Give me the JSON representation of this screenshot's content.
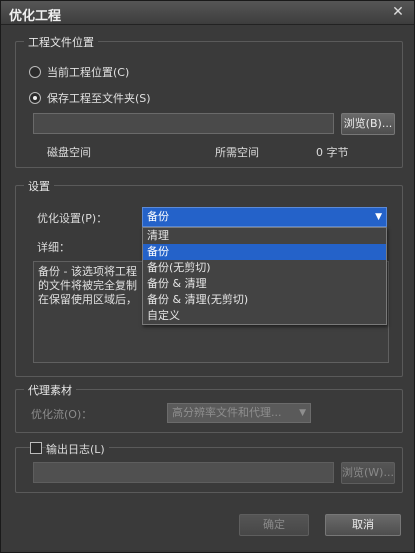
{
  "window": {
    "title": "优化工程",
    "close": "✕"
  },
  "project_location": {
    "group_title": "工程文件位置",
    "radio_current": "当前工程位置(C)",
    "radio_save": "保存工程至文件夹(S)",
    "folder_value": "",
    "browse_label": "浏览(B)...",
    "disk_space_label": "磁盘空间",
    "required_space_label": "所需空间",
    "required_space_value": "0 字节"
  },
  "settings": {
    "group_title": "设置",
    "optimize_label": "优化设置(P)：",
    "optimize_value": "备份",
    "detail_label": "详细：",
    "options": [
      "清理",
      "备份",
      "备份(无剪切)",
      "备份 & 清理",
      "备份 & 清理(无剪切)",
      "自定义"
    ],
    "selected_index": 1,
    "description_lines": [
      "备份 - 该选项将工程",
      "的文件将被完全复制",
      "在保留使用区域后，"
    ]
  },
  "proxy": {
    "group_title": "代理素材",
    "flow_label": "优化流(O)：",
    "flow_value": "高分辨率文件和代理..."
  },
  "log": {
    "checkbox_label": "输出日志(L)",
    "checked": false,
    "path_value": "",
    "browse_label": "浏览(W)..."
  },
  "footer": {
    "ok_label": "确定",
    "cancel_label": "取消"
  }
}
